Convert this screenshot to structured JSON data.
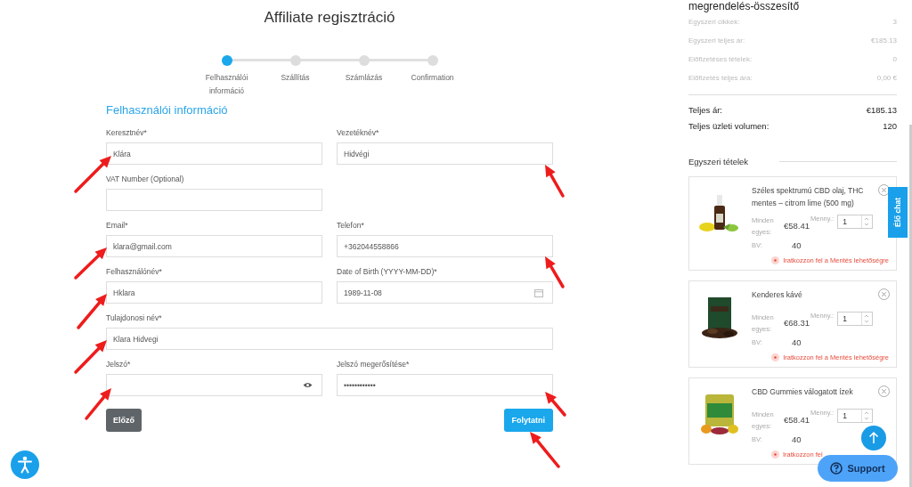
{
  "page_title": "Affiliate regisztráció",
  "steps": [
    {
      "label": "Felhasználói információ",
      "selected": true
    },
    {
      "label": "Szállítás",
      "selected": false
    },
    {
      "label": "Számlázás",
      "selected": false
    },
    {
      "label": "Confirmation",
      "selected": false
    }
  ],
  "section_title": "Felhasználói információ",
  "form_rows": [
    [
      {
        "label": "Keresztnév*",
        "value": "Klára",
        "kind": "text"
      },
      {
        "label": "Vezetéknév*",
        "value": "Hidvégi",
        "kind": "text"
      }
    ],
    [
      {
        "label": "VAT Number (Optional)",
        "kind": "text"
      }
    ],
    [
      {
        "label": "Email*",
        "value": "klara@gmail.com",
        "kind": "text"
      },
      {
        "label": "Telefon*",
        "value": "+362044558866",
        "kind": "text"
      }
    ],
    [
      {
        "label": "Felhasználónév*",
        "value": "Hklara",
        "kind": "text"
      },
      {
        "label": "Date of Birth (YYYY-MM-DD)*",
        "value": "1989-11-08",
        "kind": "date"
      }
    ],
    [
      {
        "label": "Tulajdonosi név*",
        "value": "Klara Hidvegi",
        "kind": "text",
        "full_width": true
      }
    ],
    [
      {
        "label": "Jelszó*",
        "kind": "password_reveal"
      },
      {
        "label": "Jelszó megerősítése*",
        "value": "••••••••••••",
        "kind": "text"
      }
    ]
  ],
  "buttons": {
    "back": "Előző",
    "next": "Folytatni"
  },
  "summary": {
    "title": "megrendelés-összesítő",
    "rows": [
      {
        "label": "Egyszeri cikkek:",
        "value": "3"
      },
      {
        "label": "Egyszeri teljes ár:",
        "value": "€185.13"
      },
      {
        "label": "Előfizetéses tételek:",
        "value": "0"
      },
      {
        "label": "Előfizetés teljes ára:",
        "value": "0,00 €"
      }
    ],
    "totals": [
      {
        "label": "Teljes ár:",
        "value": "€185.13"
      },
      {
        "label": "Teljes üzleti volumen:",
        "value": "120"
      }
    ],
    "items_heading": "Egyszeri tételek",
    "items": [
      {
        "title": "Széles spektrumú CBD olaj, THC mentes – citrom lime (500 mg)",
        "unit_label": "Minden egyes:",
        "price": "€58.41",
        "qty_label": "Menny.:",
        "qty": "1",
        "bv_label": "BV:",
        "bv": "40",
        "promo": "Iratkozzon fel a Mentés lehetőségre"
      },
      {
        "title": "Kenderes kávé",
        "unit_label": "Minden egyes:",
        "price": "€68.31",
        "qty_label": "Menny.:",
        "qty": "1",
        "bv_label": "BV:",
        "bv": "40",
        "promo": "Iratkozzon fel a Mentés lehetőségre"
      },
      {
        "title": "CBD Gummies válogatott ízek",
        "unit_label": "Minden egyes:",
        "price": "€58.41",
        "qty_label": "Menny.:",
        "qty": "1",
        "bv_label": "BV:",
        "bv": "40",
        "promo": "Iratkozzon fel"
      }
    ]
  },
  "chat_tab": "Élő chat",
  "support_button": "Support"
}
